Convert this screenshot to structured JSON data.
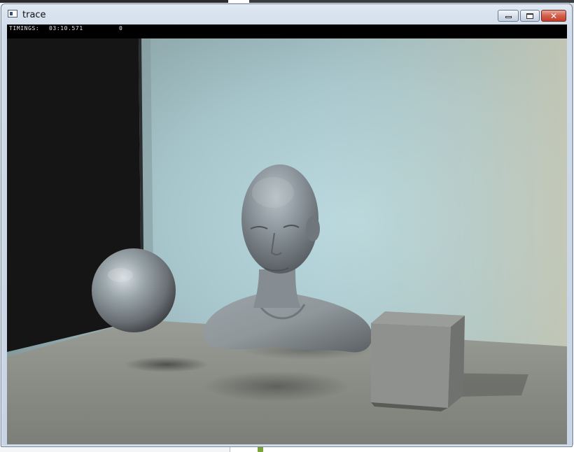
{
  "window": {
    "title": "trace",
    "icon": "app-window-icon",
    "buttons": {
      "minimize": "minimize-icon",
      "maximize": "maximize-icon",
      "close": "close-icon",
      "close_glyph": "✕"
    }
  },
  "status": {
    "label": "TIMINGS:",
    "time": "03:10.571",
    "count": "0"
  },
  "colors": {
    "status_bg": "#000000",
    "status_text": "#e6e6e6",
    "close_button": "#c9452f",
    "dark_wall": "#141414",
    "back_wall": "#b4d3d8",
    "floor": "#8c8e88"
  },
  "scene": {
    "description_objects": [
      "sphere",
      "bust",
      "cube"
    ]
  }
}
